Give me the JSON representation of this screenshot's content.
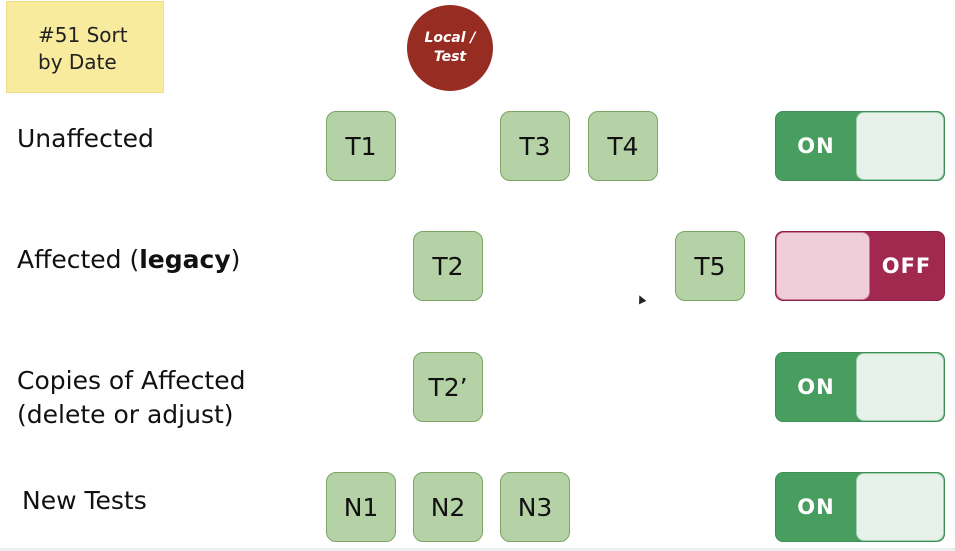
{
  "sticky_note": {
    "line1": "#51 Sort",
    "line2": "by Date"
  },
  "badge": {
    "line1": "Local /",
    "line2": "Test"
  },
  "rows": [
    {
      "label": "Unaffected",
      "tiles": [
        "T1",
        "T3",
        "T4"
      ],
      "toggle": "ON"
    },
    {
      "label_plain": "Affected (",
      "label_bold": "legacy",
      "label_end": ")",
      "tiles": [
        "T2",
        "T5"
      ],
      "toggle": "OFF"
    },
    {
      "label_line1": "Copies of Affected",
      "label_line2": "(delete or adjust)",
      "tiles": [
        "T2’"
      ],
      "toggle": "ON"
    },
    {
      "label": "New Tests",
      "tiles": [
        "N1",
        "N2",
        "N3"
      ],
      "toggle": "ON"
    }
  ],
  "colors": {
    "tile_fill": "#b5d1a6",
    "toggle_on": "#479e5f",
    "toggle_off": "#a1284e",
    "badge": "#972d22",
    "sticky": "#f8eb9d"
  }
}
